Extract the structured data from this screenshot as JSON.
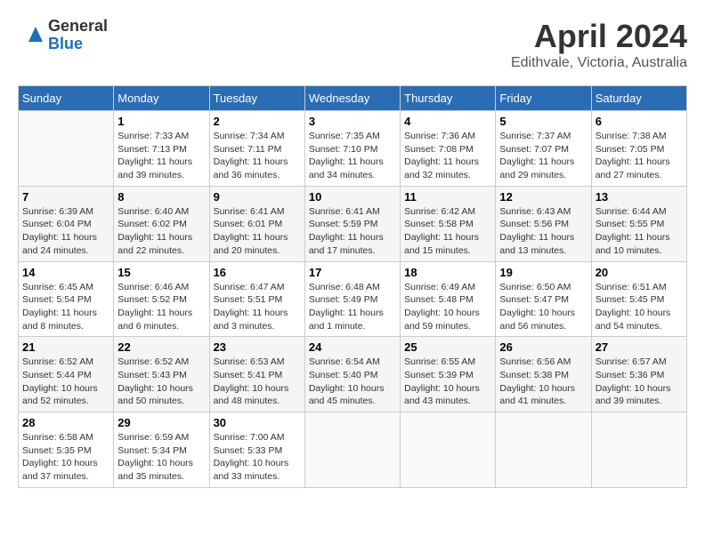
{
  "header": {
    "logo_general": "General",
    "logo_blue": "Blue",
    "title": "April 2024",
    "subtitle": "Edithvale, Victoria, Australia"
  },
  "days_of_week": [
    "Sunday",
    "Monday",
    "Tuesday",
    "Wednesday",
    "Thursday",
    "Friday",
    "Saturday"
  ],
  "weeks": [
    [
      {
        "day": "",
        "empty": true
      },
      {
        "day": "1",
        "sunrise": "7:33 AM",
        "sunset": "7:13 PM",
        "daylight": "11 hours and 39 minutes."
      },
      {
        "day": "2",
        "sunrise": "7:34 AM",
        "sunset": "7:11 PM",
        "daylight": "11 hours and 36 minutes."
      },
      {
        "day": "3",
        "sunrise": "7:35 AM",
        "sunset": "7:10 PM",
        "daylight": "11 hours and 34 minutes."
      },
      {
        "day": "4",
        "sunrise": "7:36 AM",
        "sunset": "7:08 PM",
        "daylight": "11 hours and 32 minutes."
      },
      {
        "day": "5",
        "sunrise": "7:37 AM",
        "sunset": "7:07 PM",
        "daylight": "11 hours and 29 minutes."
      },
      {
        "day": "6",
        "sunrise": "7:38 AM",
        "sunset": "7:05 PM",
        "daylight": "11 hours and 27 minutes."
      }
    ],
    [
      {
        "day": "7",
        "sunrise": "6:39 AM",
        "sunset": "6:04 PM",
        "daylight": "11 hours and 24 minutes."
      },
      {
        "day": "8",
        "sunrise": "6:40 AM",
        "sunset": "6:02 PM",
        "daylight": "11 hours and 22 minutes."
      },
      {
        "day": "9",
        "sunrise": "6:41 AM",
        "sunset": "6:01 PM",
        "daylight": "11 hours and 20 minutes."
      },
      {
        "day": "10",
        "sunrise": "6:41 AM",
        "sunset": "5:59 PM",
        "daylight": "11 hours and 17 minutes."
      },
      {
        "day": "11",
        "sunrise": "6:42 AM",
        "sunset": "5:58 PM",
        "daylight": "11 hours and 15 minutes."
      },
      {
        "day": "12",
        "sunrise": "6:43 AM",
        "sunset": "5:56 PM",
        "daylight": "11 hours and 13 minutes."
      },
      {
        "day": "13",
        "sunrise": "6:44 AM",
        "sunset": "5:55 PM",
        "daylight": "11 hours and 10 minutes."
      }
    ],
    [
      {
        "day": "14",
        "sunrise": "6:45 AM",
        "sunset": "5:54 PM",
        "daylight": "11 hours and 8 minutes."
      },
      {
        "day": "15",
        "sunrise": "6:46 AM",
        "sunset": "5:52 PM",
        "daylight": "11 hours and 6 minutes."
      },
      {
        "day": "16",
        "sunrise": "6:47 AM",
        "sunset": "5:51 PM",
        "daylight": "11 hours and 3 minutes."
      },
      {
        "day": "17",
        "sunrise": "6:48 AM",
        "sunset": "5:49 PM",
        "daylight": "11 hours and 1 minute."
      },
      {
        "day": "18",
        "sunrise": "6:49 AM",
        "sunset": "5:48 PM",
        "daylight": "10 hours and 59 minutes."
      },
      {
        "day": "19",
        "sunrise": "6:50 AM",
        "sunset": "5:47 PM",
        "daylight": "10 hours and 56 minutes."
      },
      {
        "day": "20",
        "sunrise": "6:51 AM",
        "sunset": "5:45 PM",
        "daylight": "10 hours and 54 minutes."
      }
    ],
    [
      {
        "day": "21",
        "sunrise": "6:52 AM",
        "sunset": "5:44 PM",
        "daylight": "10 hours and 52 minutes."
      },
      {
        "day": "22",
        "sunrise": "6:52 AM",
        "sunset": "5:43 PM",
        "daylight": "10 hours and 50 minutes."
      },
      {
        "day": "23",
        "sunrise": "6:53 AM",
        "sunset": "5:41 PM",
        "daylight": "10 hours and 48 minutes."
      },
      {
        "day": "24",
        "sunrise": "6:54 AM",
        "sunset": "5:40 PM",
        "daylight": "10 hours and 45 minutes."
      },
      {
        "day": "25",
        "sunrise": "6:55 AM",
        "sunset": "5:39 PM",
        "daylight": "10 hours and 43 minutes."
      },
      {
        "day": "26",
        "sunrise": "6:56 AM",
        "sunset": "5:38 PM",
        "daylight": "10 hours and 41 minutes."
      },
      {
        "day": "27",
        "sunrise": "6:57 AM",
        "sunset": "5:36 PM",
        "daylight": "10 hours and 39 minutes."
      }
    ],
    [
      {
        "day": "28",
        "sunrise": "6:58 AM",
        "sunset": "5:35 PM",
        "daylight": "10 hours and 37 minutes."
      },
      {
        "day": "29",
        "sunrise": "6:59 AM",
        "sunset": "5:34 PM",
        "daylight": "10 hours and 35 minutes."
      },
      {
        "day": "30",
        "sunrise": "7:00 AM",
        "sunset": "5:33 PM",
        "daylight": "10 hours and 33 minutes."
      },
      {
        "day": "",
        "empty": true
      },
      {
        "day": "",
        "empty": true
      },
      {
        "day": "",
        "empty": true
      },
      {
        "day": "",
        "empty": true
      }
    ]
  ]
}
